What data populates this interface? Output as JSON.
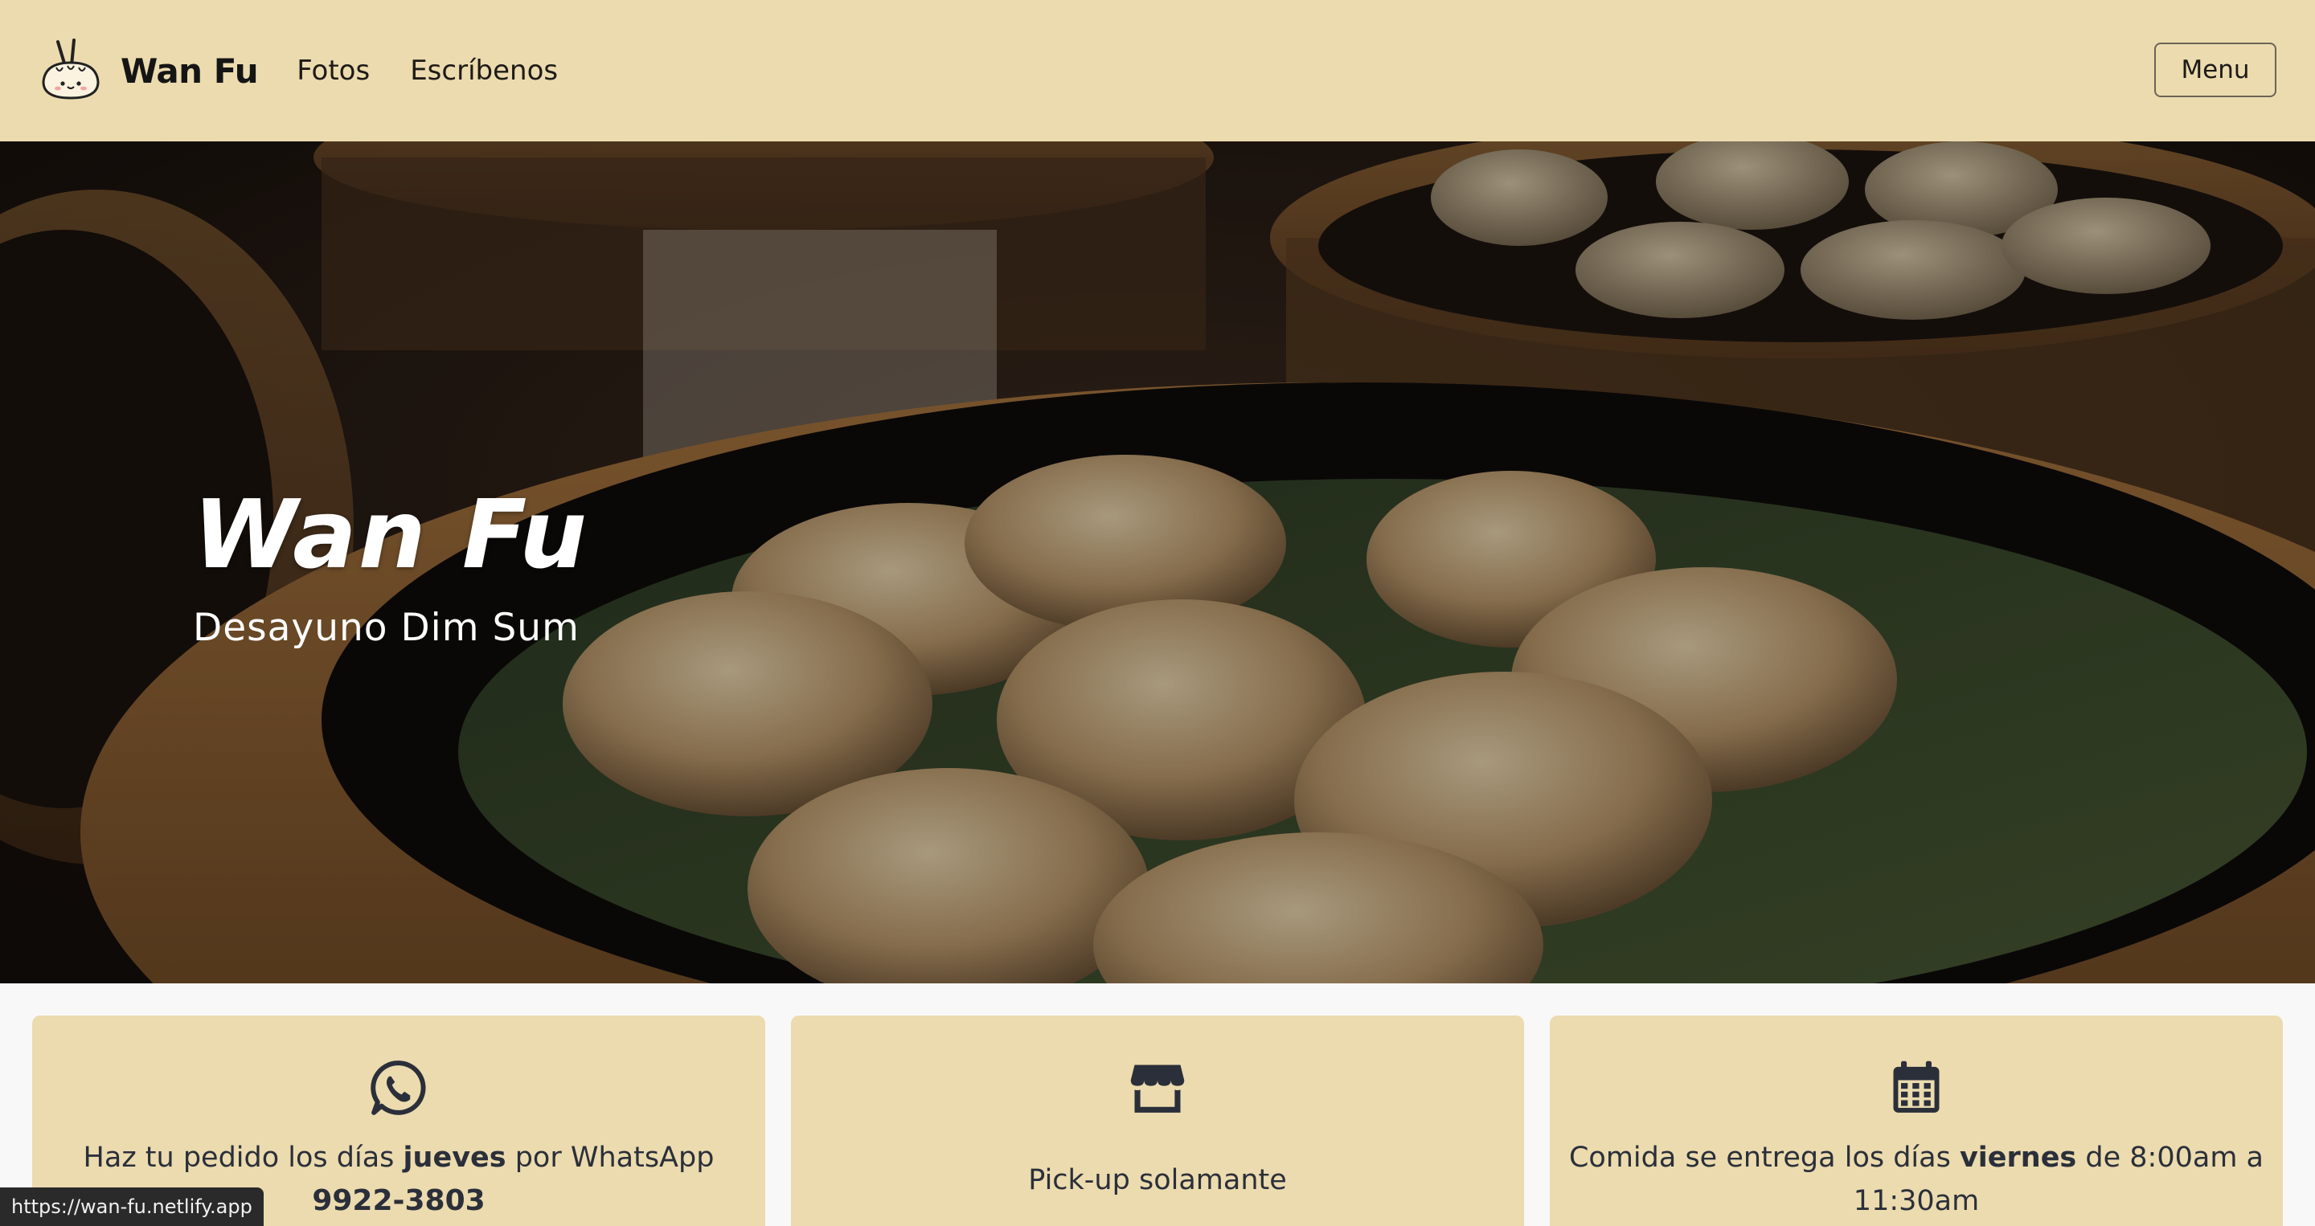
{
  "brand": {
    "name": "Wan Fu"
  },
  "nav": {
    "links": [
      "Fotos",
      "Escríbenos"
    ],
    "menu_label": "Menu"
  },
  "hero": {
    "title": "Wan Fu",
    "subtitle": "Desayuno Dim Sum"
  },
  "cards": {
    "order": {
      "icon": "whatsapp-icon",
      "text_before": "Haz tu pedido los días ",
      "text_bold": "jueves",
      "text_after": " por WhatsApp",
      "phone": "9922-3803"
    },
    "pickup": {
      "icon": "store-icon",
      "text": "Pick-up solamante"
    },
    "delivery": {
      "icon": "calendar-icon",
      "text_before": "Comida se entrega los días ",
      "text_bold": "viernes",
      "text_after": " de 8:00am a 11:30am"
    }
  },
  "status_url": "https://wan-fu.netlify.app",
  "colors": {
    "navbar_bg": "#ebdbae",
    "card_bg": "#ebdbae",
    "icon_color": "#2b2f3a"
  }
}
